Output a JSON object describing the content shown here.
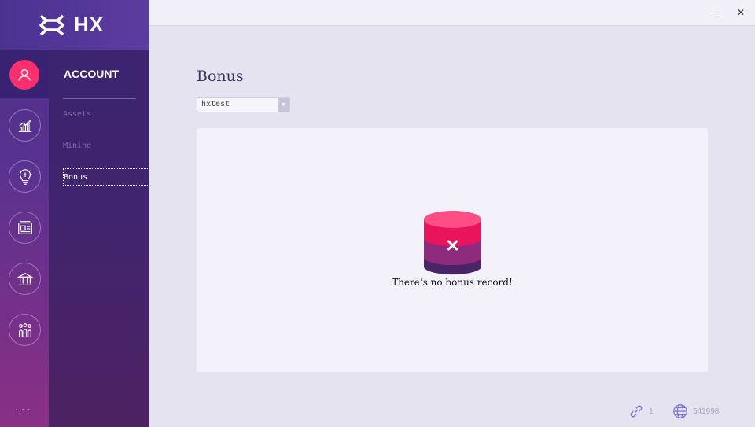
{
  "brand": {
    "name": "HX"
  },
  "rail": {
    "items": [
      {
        "icon": "user-icon",
        "active": true
      },
      {
        "icon": "chart-growth-icon",
        "active": false
      },
      {
        "icon": "lightbulb-icon",
        "active": false
      },
      {
        "icon": "id-card-icon",
        "active": false
      },
      {
        "icon": "bank-icon",
        "active": false
      },
      {
        "icon": "community-icon",
        "active": false
      }
    ],
    "more_label": "..."
  },
  "nav": {
    "title": "ACCOUNT",
    "items": [
      {
        "label": "Assets"
      },
      {
        "label": "Mining"
      },
      {
        "label": "Bonus"
      }
    ]
  },
  "window": {
    "minimize": "−",
    "close": "✕"
  },
  "main": {
    "title": "Bonus",
    "select": {
      "value": "hxtest"
    },
    "empty_message": "There’s no bonus record!"
  },
  "status": {
    "connections": "1",
    "block_height": "541998"
  },
  "colors": {
    "accent": "#ff2f6e",
    "rail_top": "#4a2f86",
    "rail_bottom": "#8a2f86",
    "nav_bg": "#3a2470",
    "page_bg": "#e6e3f0",
    "panel_bg": "#f3f1fa"
  }
}
